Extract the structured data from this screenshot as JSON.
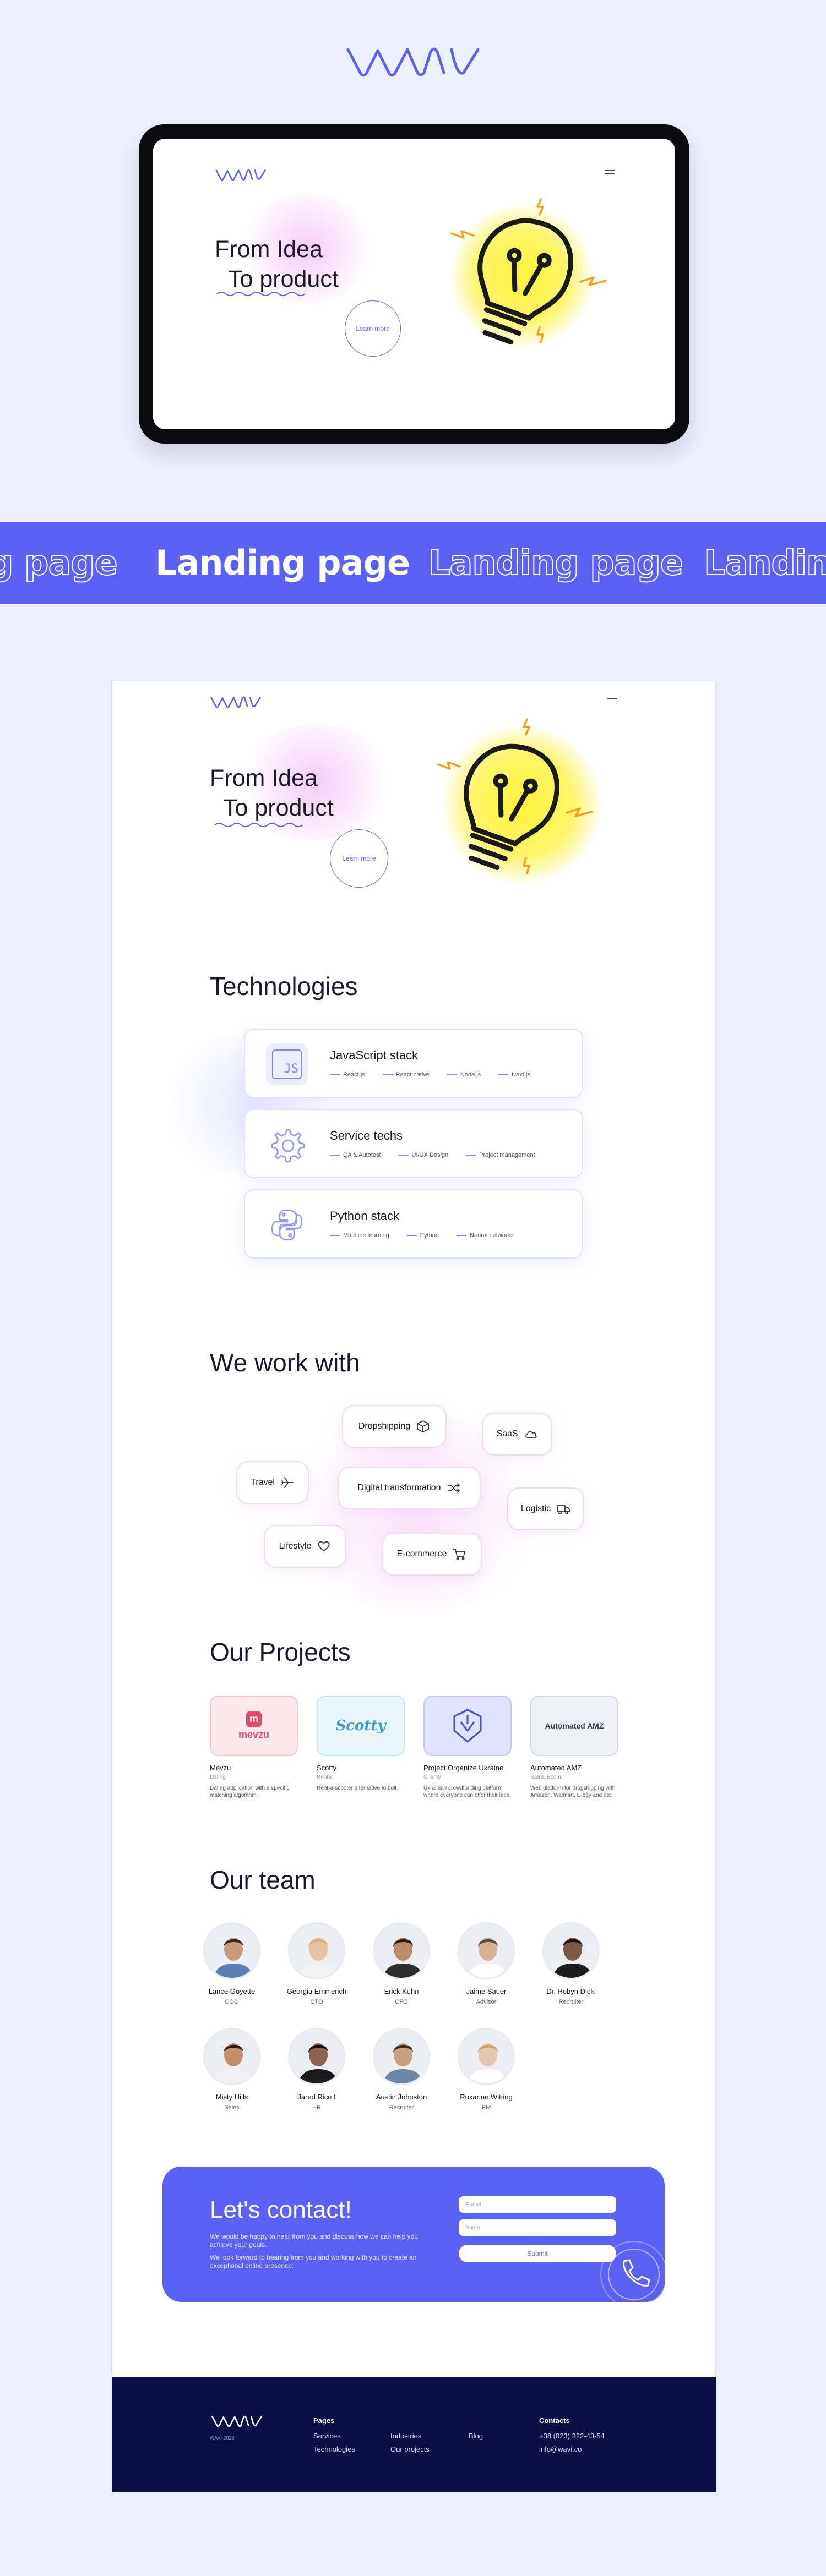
{
  "brand": {
    "logo_text": "WAVI",
    "accent": "#5a62f5",
    "footer_bg": "#0b0f45"
  },
  "hero": {
    "title_line1": "From Idea",
    "title_line2": "To product",
    "cta": "Learn more"
  },
  "banner": {
    "items": [
      "g page",
      "Landing page",
      "Landing page",
      "Landin"
    ]
  },
  "technologies": {
    "title": "Technologies",
    "cards": [
      {
        "title": "JavaScript stack",
        "icon": "js-icon",
        "icon_label": "JS",
        "tags": [
          "React.js",
          "React native",
          "Node.js",
          "Next.js"
        ]
      },
      {
        "title": "Service techs",
        "icon": "gear-icon",
        "tags": [
          "QA & Autotest",
          "UI/UX Design",
          "Project management"
        ]
      },
      {
        "title": "Python stack",
        "icon": "python-icon",
        "tags": [
          "Machine learning",
          "Python",
          "Neural networks"
        ]
      }
    ]
  },
  "work_with": {
    "title": "We work with",
    "items": [
      "Dropshipping",
      "SaaS",
      "Travel",
      "Digital transformation",
      "Logistic",
      "Lifestyle",
      "E-commerce"
    ]
  },
  "projects": {
    "title": "Our Projects",
    "items": [
      {
        "name": "Mevzu",
        "category": "Dating",
        "desc": "Dating application with a specific matching algorithm",
        "logo": "mevzu"
      },
      {
        "name": "Scotty",
        "category": "Rental",
        "desc": "Rent-a-scooter alternative to bolt.",
        "logo": "Scotty"
      },
      {
        "name": "Project Organize Ukraine",
        "category": "Charity",
        "desc": "Ukrainian crowdfunding platform where everyone can offer their idea",
        "logo": ""
      },
      {
        "name": "Automated AMZ",
        "category": "SaaS, Ecom",
        "desc": "Web platform for dropshipping with Amazon, Walmart, E-bay and etc.",
        "logo": "Automated AMZ"
      }
    ]
  },
  "team": {
    "title": "Our team",
    "members": [
      {
        "name": "Lance Goyette",
        "role": "COO"
      },
      {
        "name": "Georgia Emmerich",
        "role": "CTO"
      },
      {
        "name": "Erick Kuhn",
        "role": "CFO"
      },
      {
        "name": "Jaime Sauer",
        "role": "Advisor"
      },
      {
        "name": "Dr. Robyn Dicki",
        "role": "Recruiter"
      },
      {
        "name": "Misty Hills",
        "role": "Sales"
      },
      {
        "name": "Jared Rice I",
        "role": "HR"
      },
      {
        "name": "Austin Johnston",
        "role": "Recruiter"
      },
      {
        "name": "Roxanne Witting",
        "role": "PM"
      }
    ]
  },
  "contact": {
    "title": "Let's contact!",
    "text1": "We would be happy to hear from you and discuss how we can help you achieve your goals.",
    "text2": "We look forward to hearing from you and working with you to create an exceptional online presence.",
    "email_placeholder": "E-mail",
    "name_placeholder": "Name",
    "submit": "Submit"
  },
  "footer": {
    "logo_sub": "WAVI 2023",
    "pages_head": "Pages",
    "links_col1": [
      "Services",
      "Technologies"
    ],
    "links_col2": [
      "Industries",
      "Our projects"
    ],
    "links_col3": [
      "Blog"
    ],
    "contacts_head": "Contacts",
    "phone": "+38 (023) 322-43-54",
    "email": "info@wavi.co"
  }
}
